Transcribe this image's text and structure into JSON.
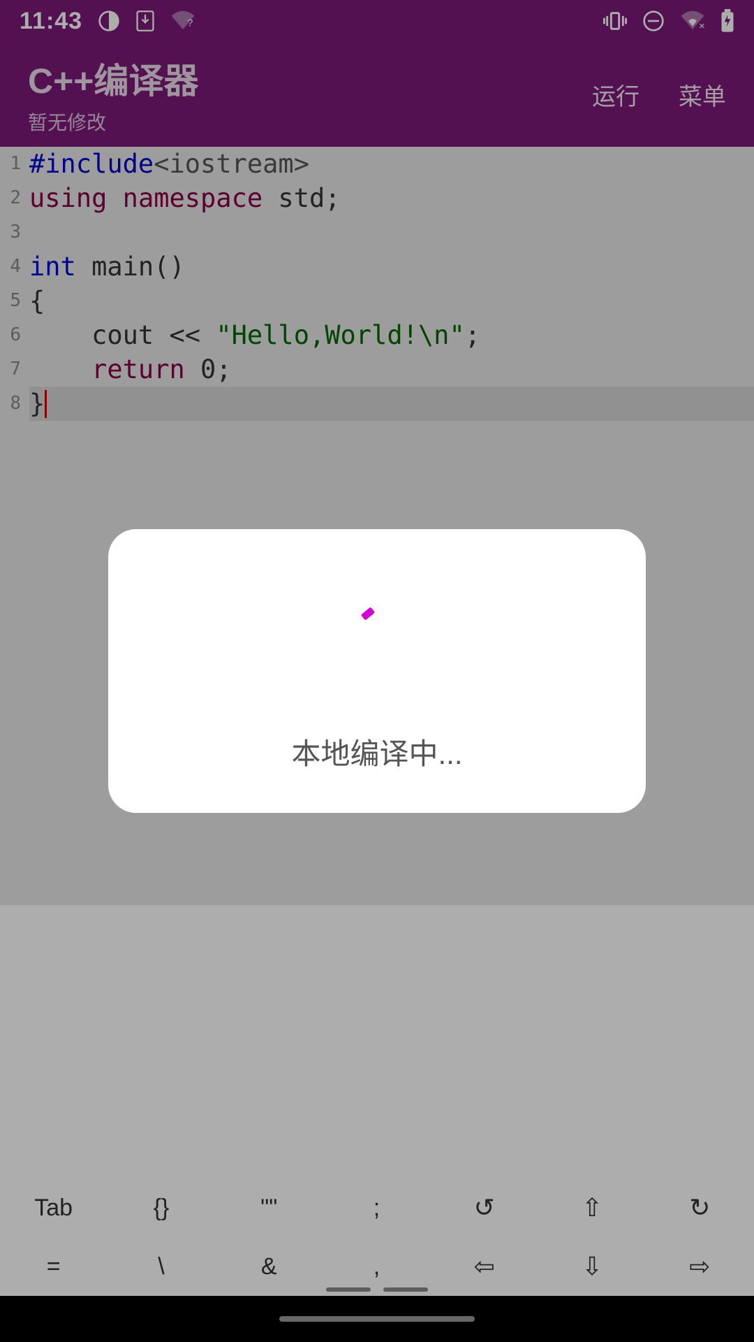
{
  "status": {
    "time": "11:43",
    "icons_left": [
      "theme-icon",
      "download-icon",
      "wifi-question-icon"
    ],
    "icons_right": [
      "vibrate-icon",
      "dnd-icon",
      "wifi-off-icon",
      "battery-charging-icon"
    ]
  },
  "appbar": {
    "title": "C++编译器",
    "subtitle": "暂无修改",
    "action_run": "运行",
    "action_menu": "菜单"
  },
  "code": {
    "lines": [
      {
        "n": "1",
        "html": [
          [
            "preproc",
            "#include"
          ],
          [
            "tag",
            "<iostream>"
          ]
        ]
      },
      {
        "n": "2",
        "html": [
          [
            "keyword",
            "using"
          ],
          [
            "ident",
            " "
          ],
          [
            "keyword",
            "namespace"
          ],
          [
            "ident",
            " std;"
          ]
        ]
      },
      {
        "n": "3",
        "html": [
          [
            "ident",
            ""
          ]
        ]
      },
      {
        "n": "4",
        "html": [
          [
            "type",
            "int"
          ],
          [
            "ident",
            " main()"
          ]
        ]
      },
      {
        "n": "5",
        "html": [
          [
            "ident",
            "{"
          ]
        ]
      },
      {
        "n": "6",
        "html": [
          [
            "ident",
            "    cout << "
          ],
          [
            "string",
            "\"Hello,World!\\n\""
          ],
          [
            "ident",
            ";"
          ]
        ]
      },
      {
        "n": "7",
        "html": [
          [
            "ident",
            "    "
          ],
          [
            "return",
            "return"
          ],
          [
            "ident",
            " 0;"
          ]
        ]
      },
      {
        "n": "8",
        "html": [
          [
            "ident",
            "}"
          ]
        ],
        "hl": true,
        "cursor": true
      }
    ]
  },
  "keyboard": {
    "row1": [
      "Tab",
      "{}",
      "\"\"",
      ";",
      "↺",
      "⇧",
      "↻"
    ],
    "row2": [
      "=",
      "\\",
      "&",
      ",",
      "⇦",
      "⇩",
      "⇨"
    ]
  },
  "dialog": {
    "text": "本地编译中..."
  }
}
